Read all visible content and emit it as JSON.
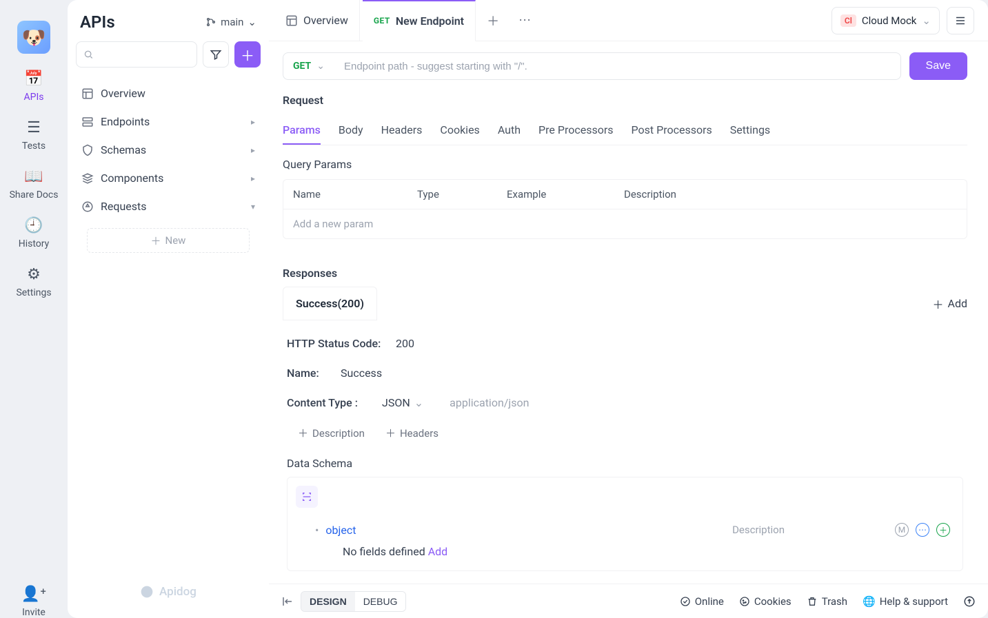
{
  "rail": {
    "items": [
      {
        "label": "APIs",
        "icon": "📅"
      },
      {
        "label": "Tests",
        "icon": "☰"
      },
      {
        "label": "Share Docs",
        "icon": "📖"
      },
      {
        "label": "History",
        "icon": "🕘"
      },
      {
        "label": "Settings",
        "icon": "⚙"
      }
    ],
    "invite": "Invite"
  },
  "tree": {
    "title": "APIs",
    "branch": "main",
    "items": [
      {
        "label": "Overview"
      },
      {
        "label": "Endpoints"
      },
      {
        "label": "Schemas"
      },
      {
        "label": "Components"
      },
      {
        "label": "Requests"
      }
    ],
    "new_label": "New",
    "brand": "Apidog"
  },
  "tabs": {
    "list": [
      {
        "label": "Overview",
        "method": ""
      },
      {
        "label": "New Endpoint",
        "method": "GET"
      }
    ]
  },
  "env": {
    "badge": "Cl",
    "label": "Cloud Mock"
  },
  "url": {
    "method": "GET",
    "placeholder": "Endpoint path - suggest starting with \"/\".",
    "save": "Save"
  },
  "request": {
    "title": "Request",
    "tabs": [
      "Params",
      "Body",
      "Headers",
      "Cookies",
      "Auth",
      "Pre Processors",
      "Post Processors",
      "Settings"
    ],
    "query_title": "Query Params",
    "columns": [
      "Name",
      "Type",
      "Example",
      "Description"
    ],
    "add_placeholder": "Add a new param"
  },
  "responses": {
    "title": "Responses",
    "tab": "Success(200)",
    "add": "Add",
    "status_label": "HTTP Status Code:",
    "status_value": "200",
    "name_label": "Name:",
    "name_value": "Success",
    "ct_label": "Content Type :",
    "ct_value": "JSON",
    "ct_hint": "application/json",
    "mini": {
      "description": "Description",
      "headers": "Headers"
    },
    "schema_title": "Data Schema",
    "schema_type": "object",
    "schema_desc_placeholder": "Description",
    "schema_empty_prefix": "No fields defined ",
    "schema_empty_link": "Add"
  },
  "footer": {
    "design": "DESIGN",
    "debug": "DEBUG",
    "online": "Online",
    "cookies": "Cookies",
    "trash": "Trash",
    "help": "Help & support"
  }
}
